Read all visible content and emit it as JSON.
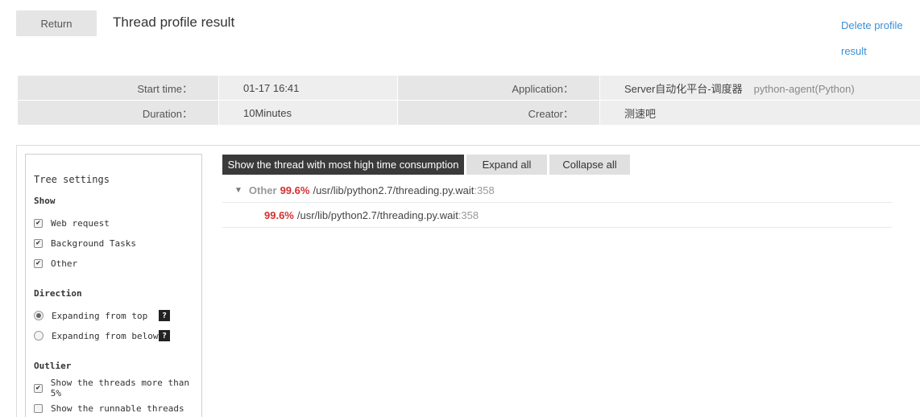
{
  "header": {
    "return_label": "Return",
    "title": "Thread profile result",
    "delete_label": "Delete profile result"
  },
  "info": {
    "start_time_label": "Start time：",
    "start_time": "01-17 16:41",
    "application_label": "Application：",
    "application": "Server自动化平台-调度器",
    "agent": "python-agent(Python)",
    "duration_label": "Duration：",
    "duration": "10Minutes",
    "creator_label": "Creator：",
    "creator": "测速吧"
  },
  "settings": {
    "title": "Tree settings",
    "show_heading": "Show",
    "show_items": [
      {
        "label": "Web request",
        "checked": true
      },
      {
        "label": "Background Tasks",
        "checked": true
      },
      {
        "label": "Other",
        "checked": true
      }
    ],
    "direction_heading": "Direction",
    "direction_items": [
      {
        "label": "Expanding from top",
        "selected": true
      },
      {
        "label": "Expanding from below",
        "selected": false
      }
    ],
    "help_glyph": "?",
    "outlier_heading": "Outlier",
    "outlier_items": [
      {
        "label": "Show the threads more than 5%",
        "checked": true
      },
      {
        "label": "Show the runnable threads",
        "checked": false
      }
    ]
  },
  "toolbar": {
    "most_time_label": "Show the thread with most high time consumption",
    "expand_label": "Expand all",
    "collapse_label": "Collapse all"
  },
  "tree": {
    "rows": [
      {
        "category": "Other",
        "percent": "99.6%",
        "path": "/usr/lib/python2.7/threading.py.wait",
        "line": ":358"
      },
      {
        "category": "",
        "percent": "99.6%",
        "path": "/usr/lib/python2.7/threading.py.wait",
        "line": ":358"
      }
    ]
  },
  "colors": {
    "accent_link": "#3a8fd6",
    "percent_red": "#d43030",
    "dark_button": "#3a3a3a"
  }
}
